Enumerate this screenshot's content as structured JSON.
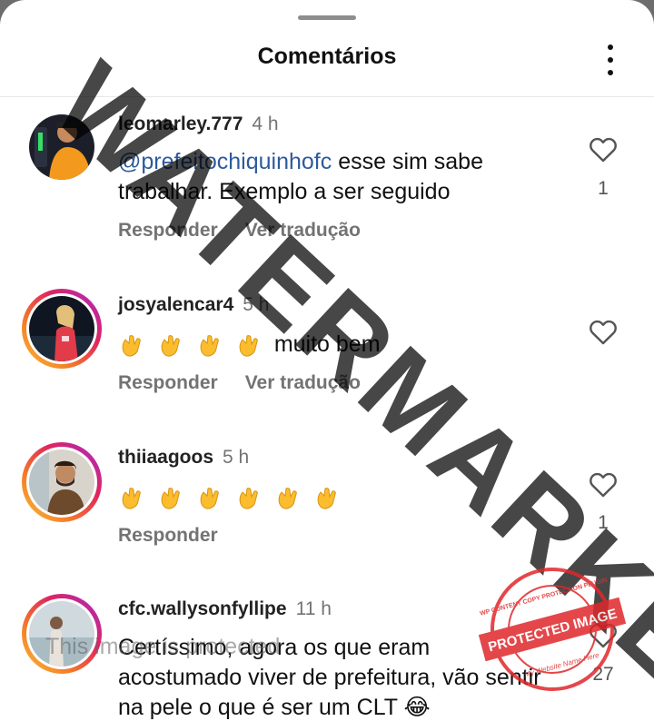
{
  "header": {
    "title": "Comentários",
    "more_icon": "more-vertical-icon"
  },
  "comments": [
    {
      "username": "leomarley.777",
      "time": "4 h",
      "mention": "@prefeitochiquinhofc",
      "text": " esse sim sabe trabalhar.  Exemplo a ser seguido",
      "reply_label": "Responder",
      "translate_label": "Ver tradução",
      "likes": "1",
      "has_story_ring": false
    },
    {
      "username": "josyalencar4",
      "time": "5 h",
      "emoji": "👏",
      "emoji_count": 4,
      "text": "muito bem",
      "reply_label": "Responder",
      "translate_label": "Ver tradução",
      "likes": "",
      "has_story_ring": true
    },
    {
      "username": "thiiaagoos",
      "time": "5 h",
      "emoji": "👏",
      "emoji_count": 6,
      "reply_label": "Responder",
      "likes": "1",
      "has_story_ring": true
    },
    {
      "username": "cfc.wallysonfyllipe",
      "time": "11 h",
      "text": "Certíssimo, agora os que eram acostumado viver de prefeitura, vão sentir na pele o que é ser um CLT",
      "emoji": "😂",
      "likes": "27",
      "has_story_ring": true
    }
  ],
  "overlay": {
    "watermark": "WATERMARKED",
    "protected_note": "This image is protected",
    "stamp_text": "PROTECTED IMAGE",
    "stamp_ring_text": "WP CONTENT COPY PROTECTION PLUGIN",
    "stamp_bottom_text": "My Website Name Here"
  },
  "colors": {
    "mention": "#2e5a9c",
    "muted": "#737373",
    "stamp_red": "#e0282b"
  }
}
